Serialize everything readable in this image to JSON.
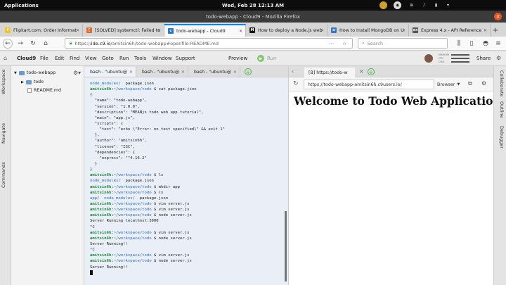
{
  "os": {
    "apps_label": "Applications",
    "clock": "Wed, Feb 28   12:13 AM"
  },
  "window": {
    "title": "todo-webapp - Cloud9 - Mozilla Firefox"
  },
  "browser_tabs": [
    {
      "label": "Flipkart.com: Order Informat",
      "fav_color": "#f3c623",
      "fav_char": "f"
    },
    {
      "label": "[SOLVED] systemctl: Failed to",
      "fav_color": "#e06b2d",
      "fav_char": "["
    },
    {
      "label": "todo-webapp - Cloud9",
      "fav_color": "#2a78c6",
      "fav_char": "c"
    },
    {
      "label": "How to deploy a Node.js web",
      "fav_color": "#111111",
      "fav_char": "M"
    },
    {
      "label": "How to Install MongoDB on U",
      "fav_color": "#3b79c8",
      "fav_char": "o"
    },
    {
      "label": "Express 4.x - API Reference",
      "fav_color": "#555555",
      "fav_char": "ex"
    }
  ],
  "navbar": {
    "url_prefix": "https://",
    "url_host": "ide.c9.io",
    "url_rest": "/amitsin6h/todo-webapp#openfile-README.md",
    "search_placeholder": "Search"
  },
  "c9menu": {
    "logo": "Cloud9",
    "items": [
      "File",
      "Edit",
      "Find",
      "View",
      "Goto",
      "Run",
      "Tools",
      "Window",
      "Support"
    ],
    "preview": "Preview",
    "run": "Run",
    "share": "Share",
    "meters": [
      "MEMORY",
      "CPU",
      "DISK"
    ]
  },
  "left_tabs": [
    "Workspace",
    "Navigate",
    "Commands"
  ],
  "right_tabs": [
    "Collaborate",
    "Outline",
    "Debugger"
  ],
  "tree": {
    "root": "todo-webapp",
    "folder": "todo",
    "file": "README.md"
  },
  "terminal_tabs": [
    "bash - \"ubuntu@",
    "bash - \"ubuntu@",
    "bash - \"ubuntu@"
  ],
  "terminal": {
    "lines": [
      {
        "kind": "ls",
        "items": [
          {
            "text": "node_modules/",
            "cls": "bl"
          },
          {
            "text": "  package.json",
            "cls": ""
          }
        ]
      },
      {
        "kind": "cmd",
        "prompt": "amitsin6h:",
        "path": "~/workspace/todo",
        "cmd": " $ cat package.json"
      },
      {
        "kind": "out",
        "text": "{"
      },
      {
        "kind": "out",
        "text": "  \"name\": \"todo-webapp\","
      },
      {
        "kind": "out",
        "text": "  \"version\": \"1.0.0\","
      },
      {
        "kind": "out",
        "text": "  \"description\": \"MEANjs todo web app tutorial\","
      },
      {
        "kind": "out",
        "text": "  \"main\": \"app.js\","
      },
      {
        "kind": "out",
        "text": "  \"scripts\": {"
      },
      {
        "kind": "out",
        "text": "    \"test\": \"echo \\\"Error: no test specified\\\" && exit 1\""
      },
      {
        "kind": "out",
        "text": "  },"
      },
      {
        "kind": "out",
        "text": "  \"author\": \"amitsin6h\","
      },
      {
        "kind": "out",
        "text": "  \"license\": \"ISC\","
      },
      {
        "kind": "out",
        "text": "  \"dependencies\": {"
      },
      {
        "kind": "out",
        "text": "    \"express\": \"^4.16.2\""
      },
      {
        "kind": "out",
        "text": "  }"
      },
      {
        "kind": "out",
        "text": "}"
      },
      {
        "kind": "cmd",
        "prompt": "amitsin6h:",
        "path": "~/workspace/todo",
        "cmd": " $ ls"
      },
      {
        "kind": "ls",
        "items": [
          {
            "text": "node_modules/",
            "cls": "bl"
          },
          {
            "text": "  package.json",
            "cls": ""
          }
        ]
      },
      {
        "kind": "cmd",
        "prompt": "amitsin6h:",
        "path": "~/workspace/todo",
        "cmd": " $ mkdir app"
      },
      {
        "kind": "cmd",
        "prompt": "amitsin6h:",
        "path": "~/workspace/todo",
        "cmd": " $ ls"
      },
      {
        "kind": "ls",
        "items": [
          {
            "text": "app/",
            "cls": "bl"
          },
          {
            "text": "  node_modules/",
            "cls": "bl"
          },
          {
            "text": "  package.json",
            "cls": ""
          }
        ]
      },
      {
        "kind": "cmd",
        "prompt": "amitsin6h:",
        "path": "~/workspace/todo",
        "cmd": " $ vim server.js"
      },
      {
        "kind": "cmd",
        "prompt": "amitsin6h:",
        "path": "~/workspace/todo",
        "cmd": " $ vim server.js"
      },
      {
        "kind": "cmd",
        "prompt": "amitsin6h:",
        "path": "~/workspace/todo",
        "cmd": " $ node server.js"
      },
      {
        "kind": "out",
        "text": "Server Running localhost:3000"
      },
      {
        "kind": "out",
        "text": "^C"
      },
      {
        "kind": "cmd",
        "prompt": "amitsin6h:",
        "path": "~/workspace/todo",
        "cmd": " $ vim server.js"
      },
      {
        "kind": "cmd",
        "prompt": "amitsin6h:",
        "path": "~/workspace/todo",
        "cmd": " $ node server.js"
      },
      {
        "kind": "out",
        "text": "Server Running!!"
      },
      {
        "kind": "out",
        "text": "^C"
      },
      {
        "kind": "cmd",
        "prompt": "amitsin6h:",
        "path": "~/workspace/todo",
        "cmd": " $ vim server.js"
      },
      {
        "kind": "cmd",
        "prompt": "amitsin6h:",
        "path": "~/workspace/todo",
        "cmd": " $ node server.js"
      },
      {
        "kind": "out",
        "text": "Server Running!!"
      },
      {
        "kind": "cursor"
      }
    ]
  },
  "preview": {
    "tab_label": "[B] https://todo-w",
    "url": "https://todo-webapp-amitsin6h.c9users.io/",
    "browser_label": "Browser",
    "heading": "Welcome to Todo Web Application!!"
  }
}
